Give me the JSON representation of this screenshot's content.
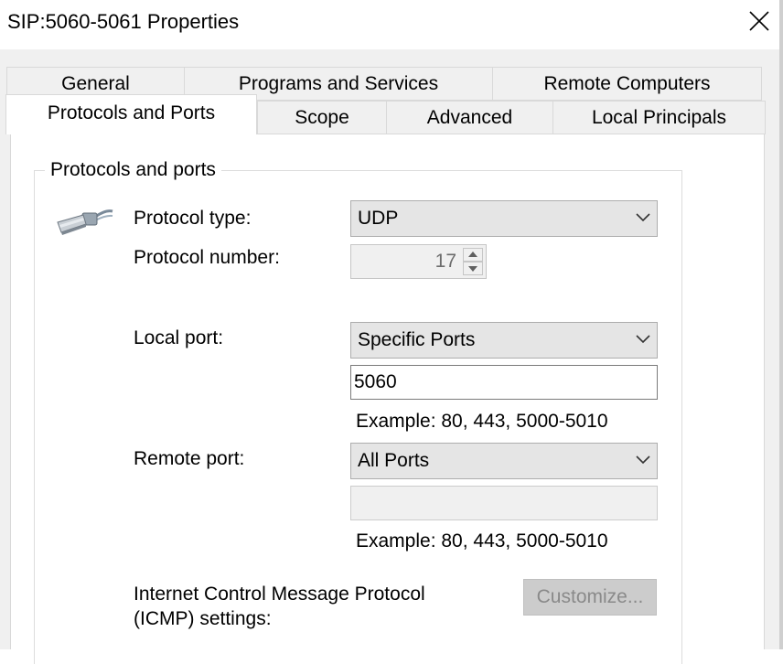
{
  "window": {
    "title": "SIP:5060-5061 Properties",
    "close_symbol": "close-icon"
  },
  "tabs": {
    "row1": [
      "General",
      "Programs and Services",
      "Remote Computers"
    ],
    "row2": [
      "Protocols and Ports",
      "Scope",
      "Advanced",
      "Local Principals"
    ],
    "active": "Protocols and Ports"
  },
  "protocols_and_ports": {
    "group_label": "Protocols and ports",
    "icon": "network-cable-plug-icon",
    "protocol_type": {
      "label": "Protocol type:",
      "value": "UDP"
    },
    "protocol_number": {
      "label": "Protocol number:",
      "value": "17",
      "disabled": true
    },
    "local_port": {
      "label": "Local port:",
      "mode": "Specific Ports",
      "value": "5060",
      "example": "Example: 80, 443, 5000-5010"
    },
    "remote_port": {
      "label": "Remote port:",
      "mode": "All Ports",
      "value": "",
      "example": "Example: 80, 443, 5000-5010",
      "value_disabled": true
    },
    "icmp": {
      "label_line1": "Internet Control Message Protocol",
      "label_line2": "(ICMP) settings:",
      "button_label": "Customize...",
      "button_disabled": true
    }
  },
  "colors": {
    "dialog_background": "#f0f0f0",
    "panel_background": "#ffffff",
    "combo_background": "#e5e5e5",
    "disabled_text": "#8a8a8a"
  }
}
